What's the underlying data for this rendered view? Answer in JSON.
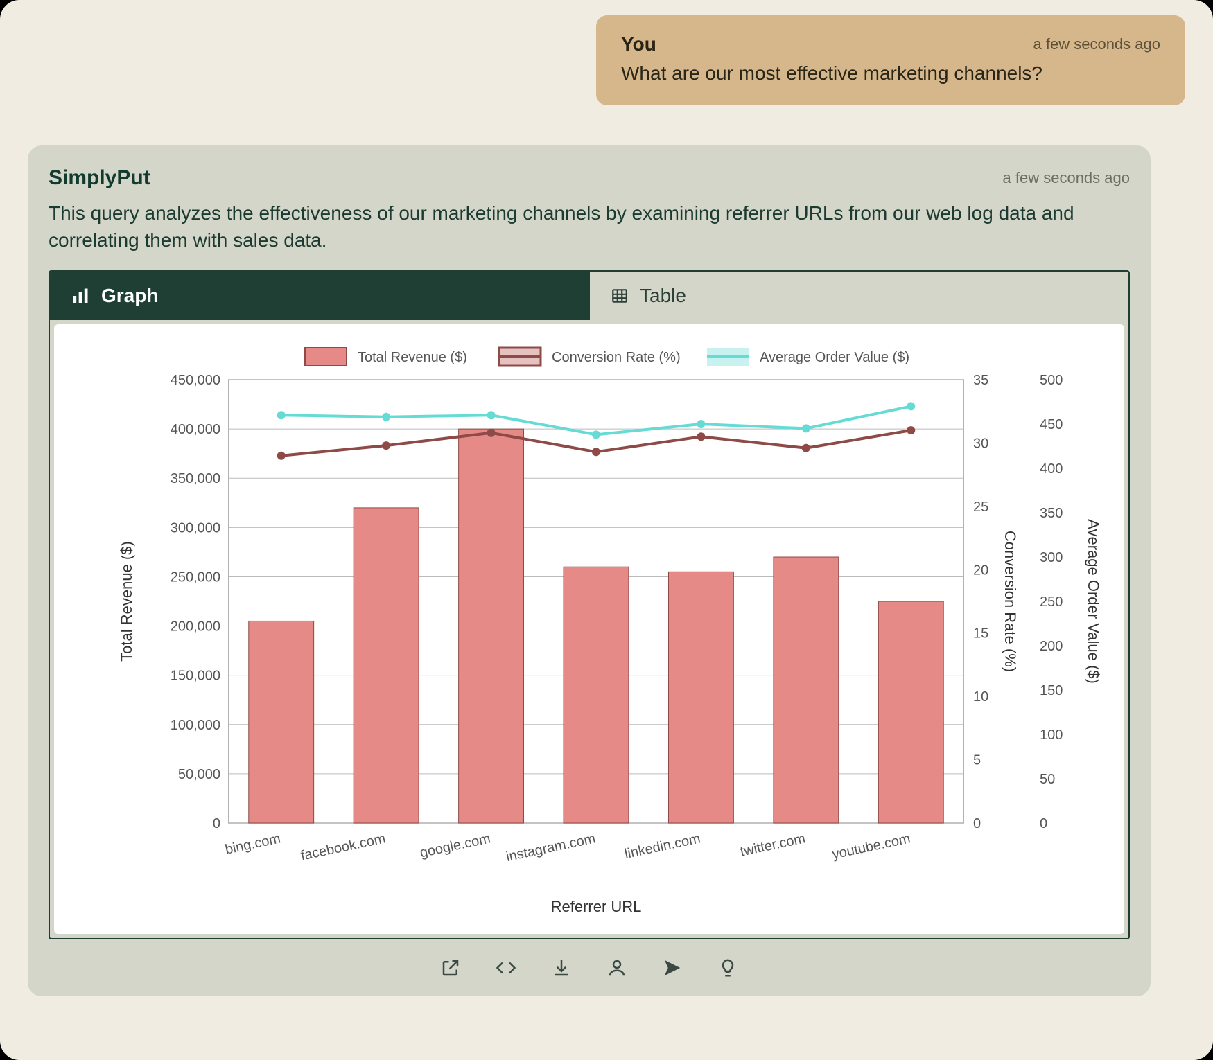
{
  "user_message": {
    "sender": "You",
    "time": "a few seconds ago",
    "text": "What are our most effective marketing channels?"
  },
  "assistant": {
    "sender": "SimplyPut",
    "time": "a few seconds ago",
    "text": "This query analyzes the effectiveness of our marketing channels by examining referrer URLs from our web log data and correlating them with sales data."
  },
  "tabs": {
    "graph": "Graph",
    "table": "Table"
  },
  "legend": {
    "revenue": "Total Revenue ($)",
    "conversion": "Conversion Rate (%)",
    "aov": "Average Order Value ($)"
  },
  "axes": {
    "left_title": "Total Revenue ($)",
    "right1_title": "Conversion Rate (%)",
    "right2_title": "Average Order Value ($)",
    "x_title": "Referrer URL",
    "left_ticks": [
      "0",
      "50,000",
      "100,000",
      "150,000",
      "200,000",
      "250,000",
      "300,000",
      "350,000",
      "400,000",
      "450,000"
    ],
    "right1_ticks": [
      "0",
      "5",
      "10",
      "15",
      "20",
      "25",
      "30",
      "35"
    ],
    "right2_ticks": [
      "0",
      "50",
      "100",
      "150",
      "200",
      "250",
      "300",
      "350",
      "400",
      "450",
      "500"
    ]
  },
  "chart_data": {
    "type": "bar",
    "categories": [
      "bing.com",
      "facebook.com",
      "google.com",
      "instagram.com",
      "linkedin.com",
      "twitter.com",
      "youtube.com"
    ],
    "series": [
      {
        "name": "Total Revenue ($)",
        "axis": "left",
        "kind": "bar",
        "values": [
          205000,
          320000,
          400000,
          260000,
          255000,
          270000,
          225000
        ]
      },
      {
        "name": "Conversion Rate (%)",
        "axis": "right1",
        "kind": "line",
        "values": [
          29.0,
          29.8,
          30.8,
          29.3,
          30.5,
          29.6,
          31.0
        ]
      },
      {
        "name": "Average Order Value ($)",
        "axis": "right2",
        "kind": "line",
        "values": [
          460,
          458,
          460,
          438,
          450,
          445,
          470
        ]
      }
    ],
    "xlabel": "Referrer URL",
    "ylabel": "Total Revenue ($)",
    "ylim_left": [
      0,
      450000
    ],
    "ylim_right1": [
      0,
      35
    ],
    "ylim_right2": [
      0,
      500
    ]
  },
  "toolbar_icons": {
    "open": "open-icon",
    "code": "code-icon",
    "download": "download-icon",
    "user": "user-icon",
    "send": "send-icon",
    "idea": "lightbulb-icon"
  }
}
